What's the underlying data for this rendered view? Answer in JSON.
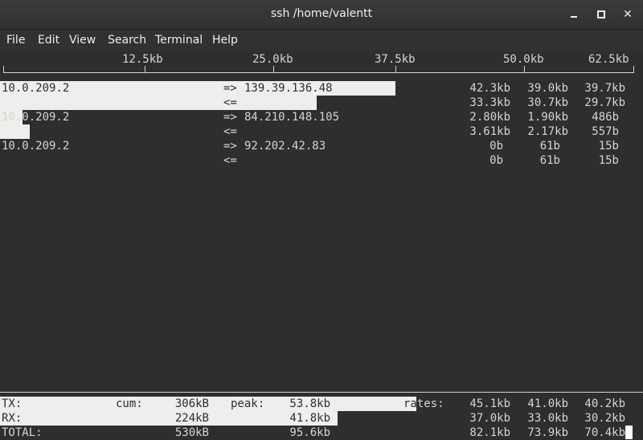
{
  "window": {
    "title": "ssh  /home/valentt"
  },
  "menu": [
    "File",
    "Edit",
    "View",
    "Search",
    "Terminal",
    "Help"
  ],
  "scale": [
    "12.5kb",
    "25.0kb",
    "37.5kb",
    "50.0kb",
    "62.5kb"
  ],
  "hosts": [
    {
      "local": "10.0.209.2",
      "remote": "139.39.136.48",
      "out": {
        "arrow": "=>",
        "r2": "42.3kb",
        "r10": "39.0kb",
        "r40": "39.7kb"
      },
      "in": {
        "arrow": "<=",
        "r2": "33.3kb",
        "r10": "30.7kb",
        "r40": "29.7kb"
      }
    },
    {
      "local": "10.0.209.2",
      "remote": "84.210.148.105",
      "out": {
        "arrow": "=>",
        "r2": "2.80kb",
        "r10": "1.90kb",
        "r40": "486b"
      },
      "in": {
        "arrow": "<=",
        "r2": "3.61kb",
        "r10": "2.17kb",
        "r40": "557b"
      }
    },
    {
      "local": "10.0.209.2",
      "remote": "92.202.42.83",
      "out": {
        "arrow": "=>",
        "r2": "0b",
        "r10": "61b",
        "r40": "15b"
      },
      "in": {
        "arrow": "<=",
        "r2": "0b",
        "r10": "61b",
        "r40": "15b"
      }
    }
  ],
  "totals": {
    "tx_label": "TX:",
    "rx_label": "RX:",
    "total_label": "TOTAL:",
    "cum_label": "cum:",
    "peak_label": "peak:",
    "rates_label": "rates:",
    "tx": {
      "cum": "306kB",
      "peak": "53.8kb",
      "r2": "45.1kb",
      "r10": "41.0kb",
      "r40": "40.2kb"
    },
    "rx": {
      "cum": "224kB",
      "peak": "41.8kb",
      "r2": "37.0kb",
      "r10": "33.0kb",
      "r40": "30.2kb"
    },
    "total": {
      "cum": "530kB",
      "peak": "95.6kb",
      "r2": "82.1kb",
      "r10": "73.9kb",
      "r40": "70.4kb"
    }
  },
  "colors": {
    "background": "#2e2e2e",
    "foreground": "#d3d7cf",
    "bar": "#eeeeec"
  }
}
